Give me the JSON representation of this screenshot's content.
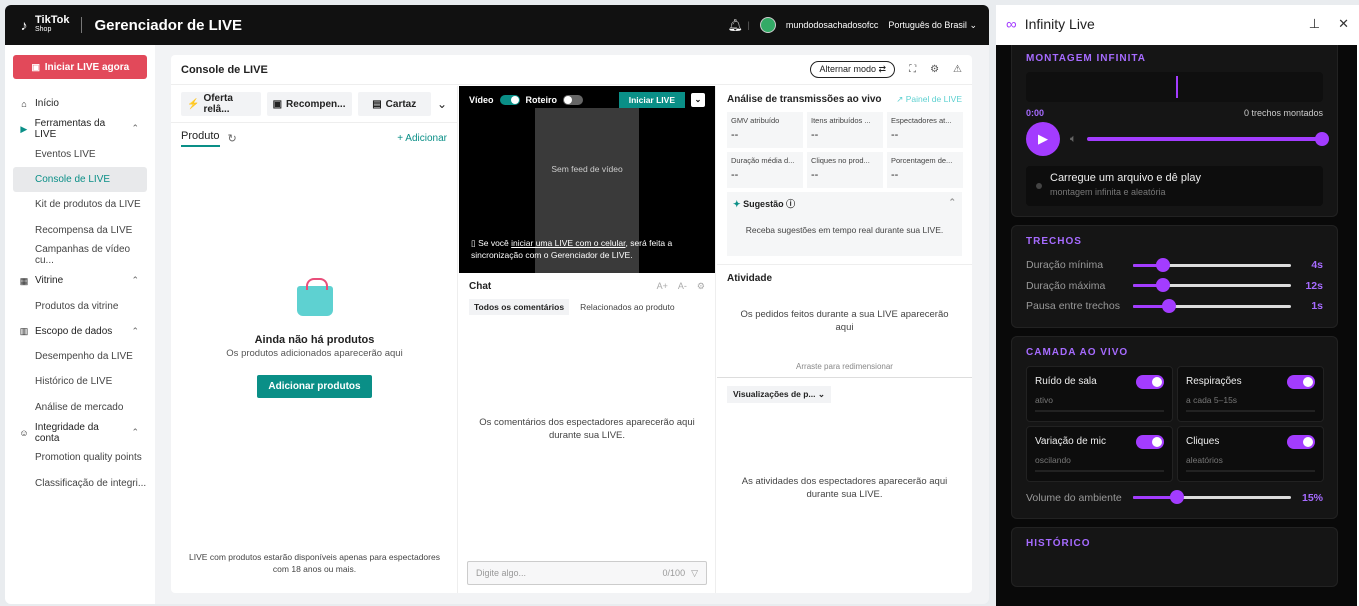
{
  "topbar": {
    "brand_main": "TikTok",
    "brand_sub": "Shop",
    "title": "Gerenciador de LIVE",
    "username": "mundodosachadosofcc",
    "language": "Português do Brasil"
  },
  "sidebar": {
    "start_live": "Iniciar LIVE agora",
    "items": [
      {
        "label": "Início",
        "type": "section"
      },
      {
        "label": "Ferramentas da LIVE",
        "type": "section"
      },
      {
        "label": "Eventos LIVE",
        "type": "sub"
      },
      {
        "label": "Console de LIVE",
        "type": "sub"
      },
      {
        "label": "Kit de produtos da LIVE",
        "type": "sub"
      },
      {
        "label": "Recompensa da LIVE",
        "type": "sub"
      },
      {
        "label": "Campanhas de vídeo cu...",
        "type": "sub"
      },
      {
        "label": "Vitrine",
        "type": "section"
      },
      {
        "label": "Produtos da vitrine",
        "type": "sub"
      },
      {
        "label": "Escopo de dados",
        "type": "section"
      },
      {
        "label": "Desempenho da LIVE",
        "type": "sub"
      },
      {
        "label": "Histórico de LIVE",
        "type": "sub"
      },
      {
        "label": "Análise de mercado",
        "type": "sub"
      },
      {
        "label": "Integridade da conta",
        "type": "section"
      },
      {
        "label": "Promotion quality points",
        "type": "sub"
      },
      {
        "label": "Classificação de integri...",
        "type": "sub"
      }
    ]
  },
  "console": {
    "title": "Console de LIVE",
    "alt_mode": "Alternar modo",
    "tools": {
      "offer": "Oferta relâ...",
      "reward": "Recompen...",
      "cart": "Cartaz"
    },
    "product_tab": "Produto",
    "add": "+ Adicionar",
    "empty_title": "Ainda não há produtos",
    "empty_sub": "Os produtos adicionados aparecerão aqui",
    "add_products": "Adicionar produtos",
    "footer_note_1": "LIVE com produtos estarão disponíveis apenas para espectadores",
    "footer_note_2": "com 18 anos ou mais."
  },
  "video": {
    "video_label": "Vídeo",
    "script_label": "Roteiro",
    "start_live": "Iniciar LIVE",
    "no_feed": "Sem feed de vídeo",
    "note_pre": "Se você ",
    "note_link": "iniciar uma LIVE com o celular",
    "note_post": ", será feita a",
    "note_line2": "sincronização com o Gerenciador de LIVE."
  },
  "chat": {
    "title": "Chat",
    "font_up": "A+",
    "font_down": "A-",
    "tab_all": "Todos os comentários",
    "tab_product": "Relacionados ao produto",
    "empty_1": "Os comentários dos espectadores aparecerão aqui",
    "empty_2": "durante sua LIVE.",
    "placeholder": "Digite algo...",
    "counter": "0/100"
  },
  "analysis": {
    "title": "Análise de transmissões ao vivo",
    "panel_link": "Painel de LIVE",
    "metrics": [
      {
        "label": "GMV atribuído",
        "value": "--"
      },
      {
        "label": "Itens atribuídos ...",
        "value": "--"
      },
      {
        "label": "Espectadores at...",
        "value": "--"
      },
      {
        "label": "Duração média d...",
        "value": "--"
      },
      {
        "label": "Cliques no prod...",
        "value": "--"
      },
      {
        "label": "Porcentagem de...",
        "value": "--"
      }
    ],
    "suggestion_title": "Sugestão",
    "suggestion_body": "Receba sugestões em tempo real durante sua LIVE."
  },
  "activity": {
    "title": "Atividade",
    "body_1": "Os pedidos feitos durante a sua LIVE aparecerão",
    "body_2": "aqui",
    "drag": "Arraste para redimensionar",
    "views_select": "Visualizações de p...",
    "views_1": "As atividades dos espectadores aparecerão aqui",
    "views_2": "durante sua LIVE."
  },
  "panel": {
    "title": "Infinity Live",
    "montage_title": "MONTAGEM INFINITA",
    "time": "0:00",
    "chunks_montados": "0 trechos montados",
    "load_title": "Carregue um arquivo e dê play",
    "load_sub": "montagem infinita e aleatória",
    "trechos_title": "TRECHOS",
    "sliders": [
      {
        "label": "Duração mínima",
        "value": "4s",
        "pct": 0.19
      },
      {
        "label": "Duração máxima",
        "value": "12s",
        "pct": 0.19
      },
      {
        "label": "Pausa entre trechos",
        "value": "1s",
        "pct": 0.23
      }
    ],
    "live_layer_title": "CAMADA AO VIVO",
    "cards": [
      {
        "title": "Ruído de sala",
        "sub": "ativo"
      },
      {
        "title": "Respirações",
        "sub": "a cada 5–15s"
      },
      {
        "title": "Variação de mic",
        "sub": "oscilando"
      },
      {
        "title": "Cliques",
        "sub": "aleatórios"
      }
    ],
    "ambient_label": "Volume do ambiente",
    "ambient_value": "15%",
    "ambient_pct": 0.28,
    "history_title": "HISTÓRICO"
  }
}
